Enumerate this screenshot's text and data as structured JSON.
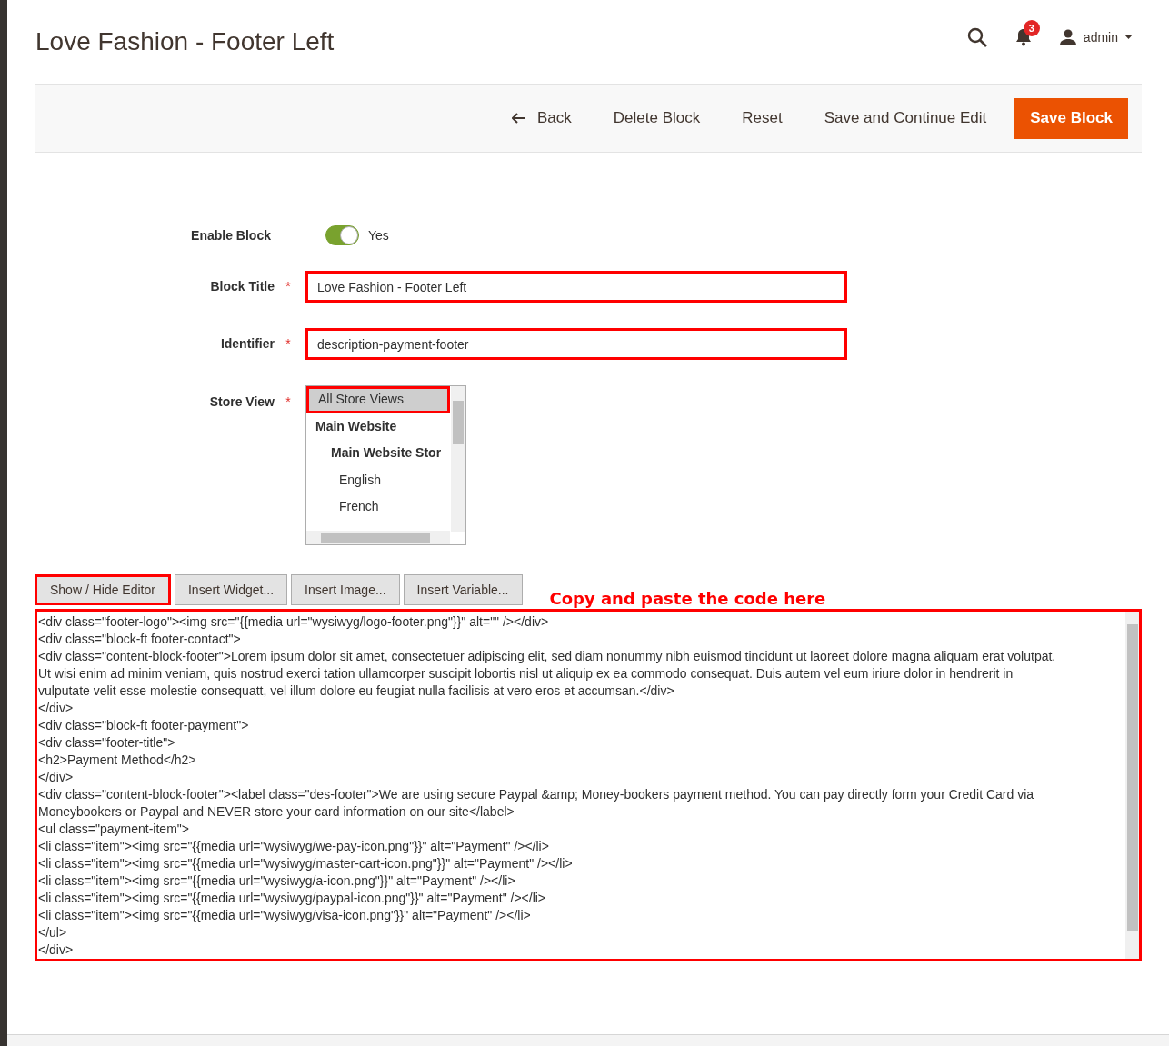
{
  "page_title": "Love Fashion - Footer Left",
  "header": {
    "notification_count": "3",
    "user": "admin"
  },
  "toolbar": [
    {
      "kind": "back",
      "label": "Back"
    },
    {
      "kind": "plain",
      "label": "Delete Block"
    },
    {
      "kind": "plain",
      "label": "Reset"
    },
    {
      "kind": "plain",
      "label": "Save and Continue Edit"
    },
    {
      "kind": "primary",
      "label": "Save Block"
    }
  ],
  "form": {
    "enable": {
      "label": "Enable Block",
      "on": true,
      "value_label": "Yes"
    },
    "fields": [
      {
        "label": "Block Title",
        "required_mark": "*",
        "value": "Love Fashion - Footer Left",
        "highlighted": true
      },
      {
        "label": "Identifier",
        "required_mark": "*",
        "value": "description-payment-footer",
        "highlighted": true
      }
    ],
    "store_view": {
      "label": "Store View",
      "required_mark": "*",
      "options": [
        {
          "label": "All Store Views",
          "selected": true,
          "highlighted": true,
          "bold": false
        },
        {
          "label": "Main Website",
          "selected": false,
          "highlighted": false,
          "bold": true,
          "children": [
            {
              "label": "Main Website Stor",
              "selected": false,
              "highlighted": false,
              "bold": true,
              "children": [
                {
                  "label": "English",
                  "selected": false,
                  "highlighted": false,
                  "bold": false
                },
                {
                  "label": "French",
                  "selected": false,
                  "highlighted": false,
                  "bold": false
                }
              ]
            }
          ]
        }
      ]
    }
  },
  "editor_buttons": [
    {
      "label": "Show / Hide Editor",
      "highlighted": true
    },
    {
      "label": "Insert Widget...",
      "highlighted": false
    },
    {
      "label": "Insert Image...",
      "highlighted": false
    },
    {
      "label": "Insert Variable...",
      "highlighted": false
    }
  ],
  "annotation": "Copy and paste the code here",
  "code_lines": [
    "<div class=\"footer-logo\"><img src=\"{{media url=\"wysiwyg/logo-footer.png\"}}\" alt=\"\" /></div>",
    "<div class=\"block-ft footer-contact\">",
    "<div class=\"content-block-footer\">Lorem ipsum dolor sit amet, consectetuer adipiscing elit, sed diam nonummy nibh euismod tincidunt ut laoreet dolore magna aliquam erat volutpat.",
    "Ut wisi enim ad minim veniam, quis nostrud exerci tation ullamcorper suscipit lobortis nisl ut aliquip ex ea commodo consequat. Duis autem vel eum iriure dolor in hendrerit in",
    "vulputate velit esse molestie consequatt, vel illum dolore eu feugiat nulla facilisis at vero eros et accumsan.</div>",
    "</div>",
    "<div class=\"block-ft footer-payment\">",
    "<div class=\"footer-title\">",
    "<h2>Payment Method</h2>",
    "</div>",
    "<div class=\"content-block-footer\"><label class=\"des-footer\">We are using secure Paypal &amp; Money-bookers payment method. You can pay directly form your Credit Card via",
    "Moneybookers or Paypal and NEVER store your card information on our site</label>",
    "<ul class=\"payment-item\">",
    "<li class=\"item\"><img src=\"{{media url=\"wysiwyg/we-pay-icon.png\"}}\" alt=\"Payment\" /></li>",
    "<li class=\"item\"><img src=\"{{media url=\"wysiwyg/master-cart-icon.png\"}}\" alt=\"Payment\" /></li>",
    "<li class=\"item\"><img src=\"{{media url=\"wysiwyg/a-icon.png\"}}\" alt=\"Payment\" /></li>",
    "<li class=\"item\"><img src=\"{{media url=\"wysiwyg/paypal-icon.png\"}}\" alt=\"Payment\" /></li>",
    "<li class=\"item\"><img src=\"{{media url=\"wysiwyg/visa-icon.png\"}}\" alt=\"Payment\" /></li>",
    "</ul>",
    "</div>"
  ]
}
